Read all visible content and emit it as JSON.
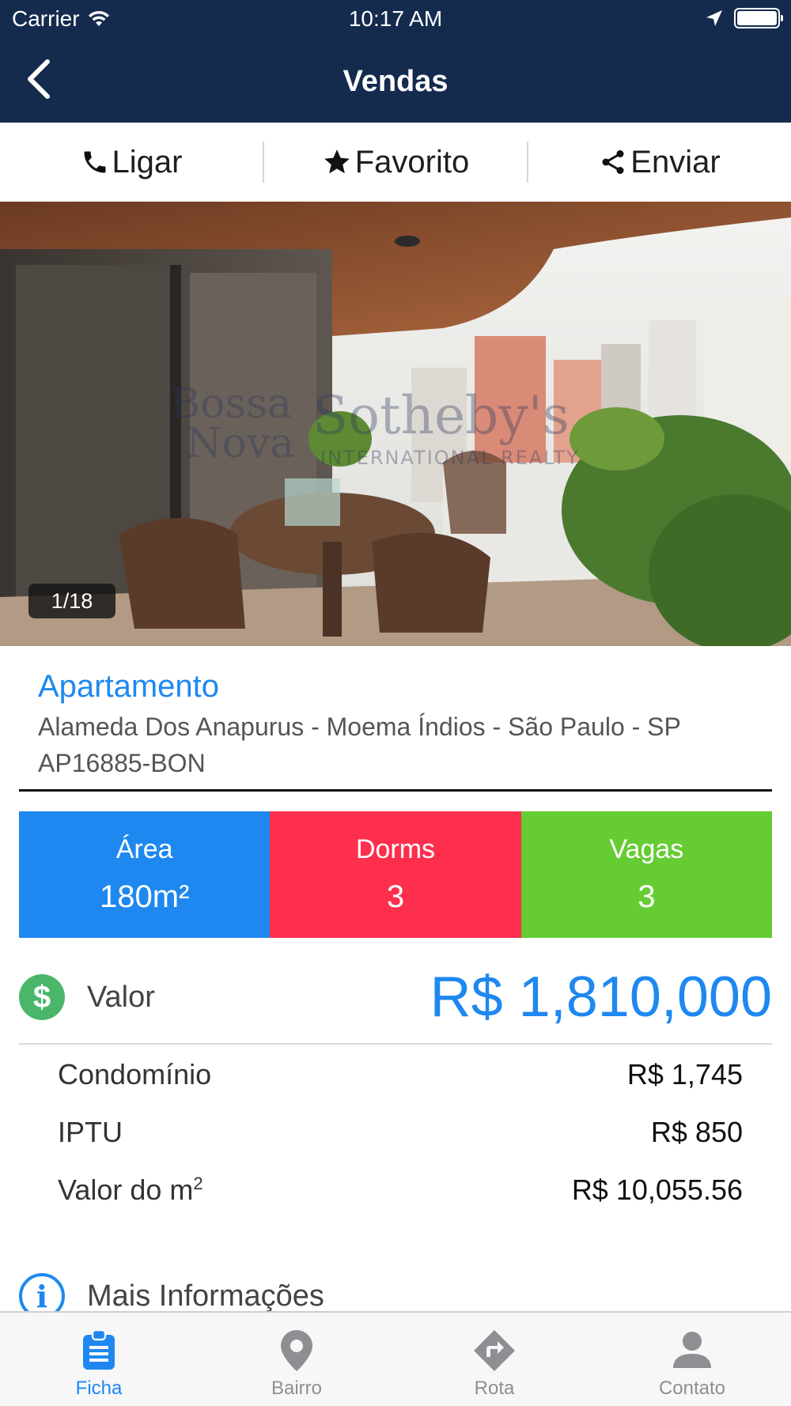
{
  "status": {
    "carrier": "Carrier",
    "time": "10:17 AM"
  },
  "nav": {
    "title": "Vendas"
  },
  "actions": {
    "call": "Ligar",
    "favorite": "Favorito",
    "send": "Enviar"
  },
  "photo": {
    "counter": "1/18",
    "watermark_line1": "Bossa",
    "watermark_line2": "Nova",
    "watermark_brand": "Sotheby's",
    "watermark_sub": "INTERNATIONAL REALTY"
  },
  "property": {
    "type": "Apartamento",
    "address": "Alameda Dos Anapurus - Moema Índios - São Paulo - SP",
    "code": "AP16885-BON"
  },
  "stats": {
    "area_label": "Área",
    "area_value": "180m²",
    "dorms_label": "Dorms",
    "dorms_value": "3",
    "vagas_label": "Vagas",
    "vagas_value": "3"
  },
  "price": {
    "label": "Valor",
    "value": "R$ 1,810,000"
  },
  "details": [
    {
      "label": "Condomínio",
      "value": "R$ 1,745"
    },
    {
      "label": "IPTU",
      "value": "R$ 850"
    },
    {
      "label": "Valor do m",
      "label_sup": "2",
      "value": "R$ 10,055.56"
    }
  ],
  "more": {
    "label": "Mais Informações"
  },
  "tabs": [
    {
      "label": "Ficha",
      "icon": "clipboard-icon",
      "active": true
    },
    {
      "label": "Bairro",
      "icon": "map-pin-icon",
      "active": false
    },
    {
      "label": "Rota",
      "icon": "route-icon",
      "active": false
    },
    {
      "label": "Contato",
      "icon": "person-icon",
      "active": false
    }
  ],
  "colors": {
    "header": "#142b4e",
    "accent": "#1e88f0",
    "area": "#1e88f0",
    "dorms": "#fe2e4d",
    "vagas": "#66cc33",
    "price_icon": "#49b66a"
  }
}
